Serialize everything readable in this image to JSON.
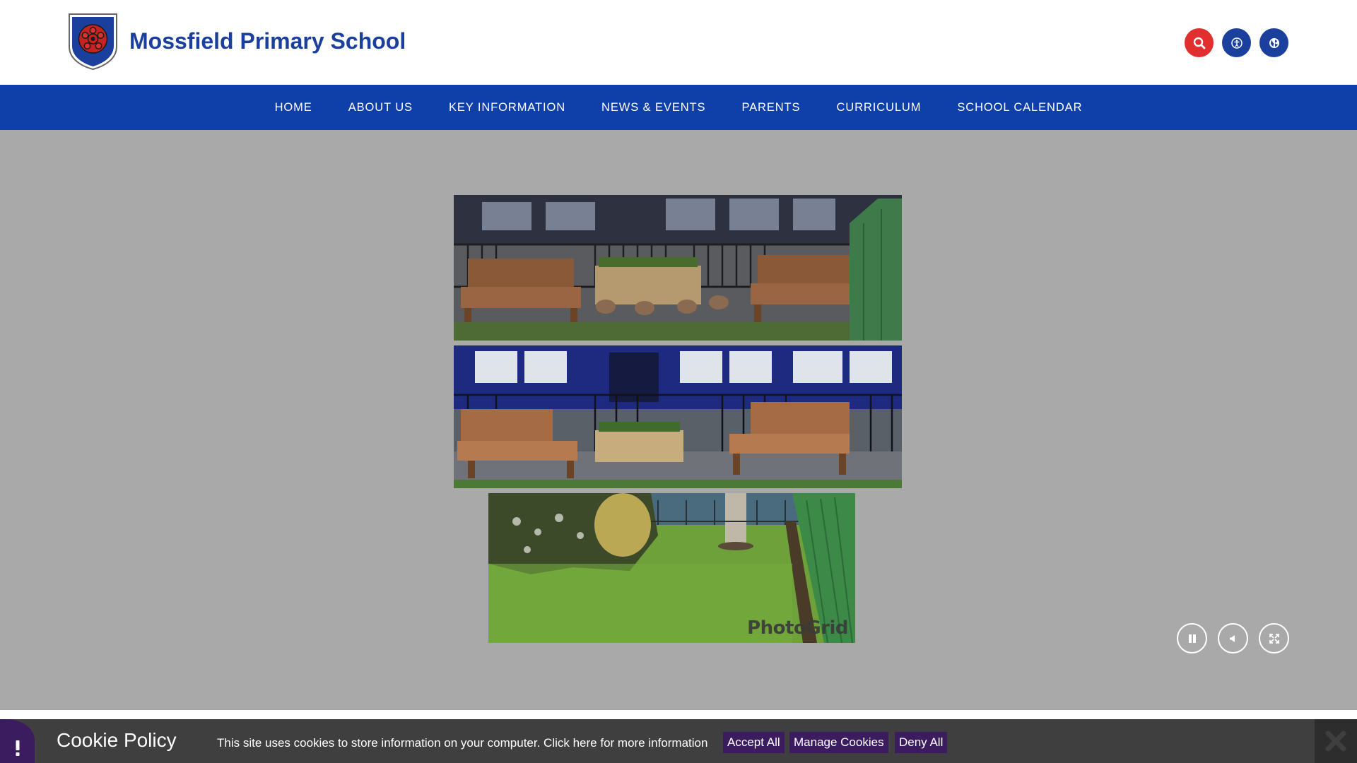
{
  "header": {
    "school_name": "Mossfield Primary School",
    "crest_icon": "school-crest-rose",
    "buttons": [
      {
        "name": "search",
        "icon": "search-icon",
        "color": "#e12e2e"
      },
      {
        "name": "accessibility",
        "icon": "accessibility-icon",
        "color": "#1a3f9c"
      },
      {
        "name": "translate",
        "icon": "globe-icon",
        "color": "#1a3f9c"
      }
    ]
  },
  "nav": {
    "color": "#0f3fa8",
    "items": [
      {
        "label": "HOME"
      },
      {
        "label": "ABOUT US"
      },
      {
        "label": "KEY INFORMATION"
      },
      {
        "label": "NEWS & EVENTS"
      },
      {
        "label": "PARENTS"
      },
      {
        "label": "CURRICULUM"
      },
      {
        "label": "SCHOOL CALENDAR"
      }
    ]
  },
  "hero": {
    "background": "#a9a9a9",
    "watermark": "PhotoGrid",
    "controls": [
      "pause-icon",
      "volume-icon",
      "fullscreen-icon"
    ]
  },
  "cookie": {
    "title": "Cookie Policy",
    "text": "This site uses cookies to store information on your computer. Click here for more information",
    "accept_label": "Accept All",
    "manage_label": "Manage Cookies",
    "deny_label": "Deny All",
    "accent": "#3b1c5e"
  }
}
